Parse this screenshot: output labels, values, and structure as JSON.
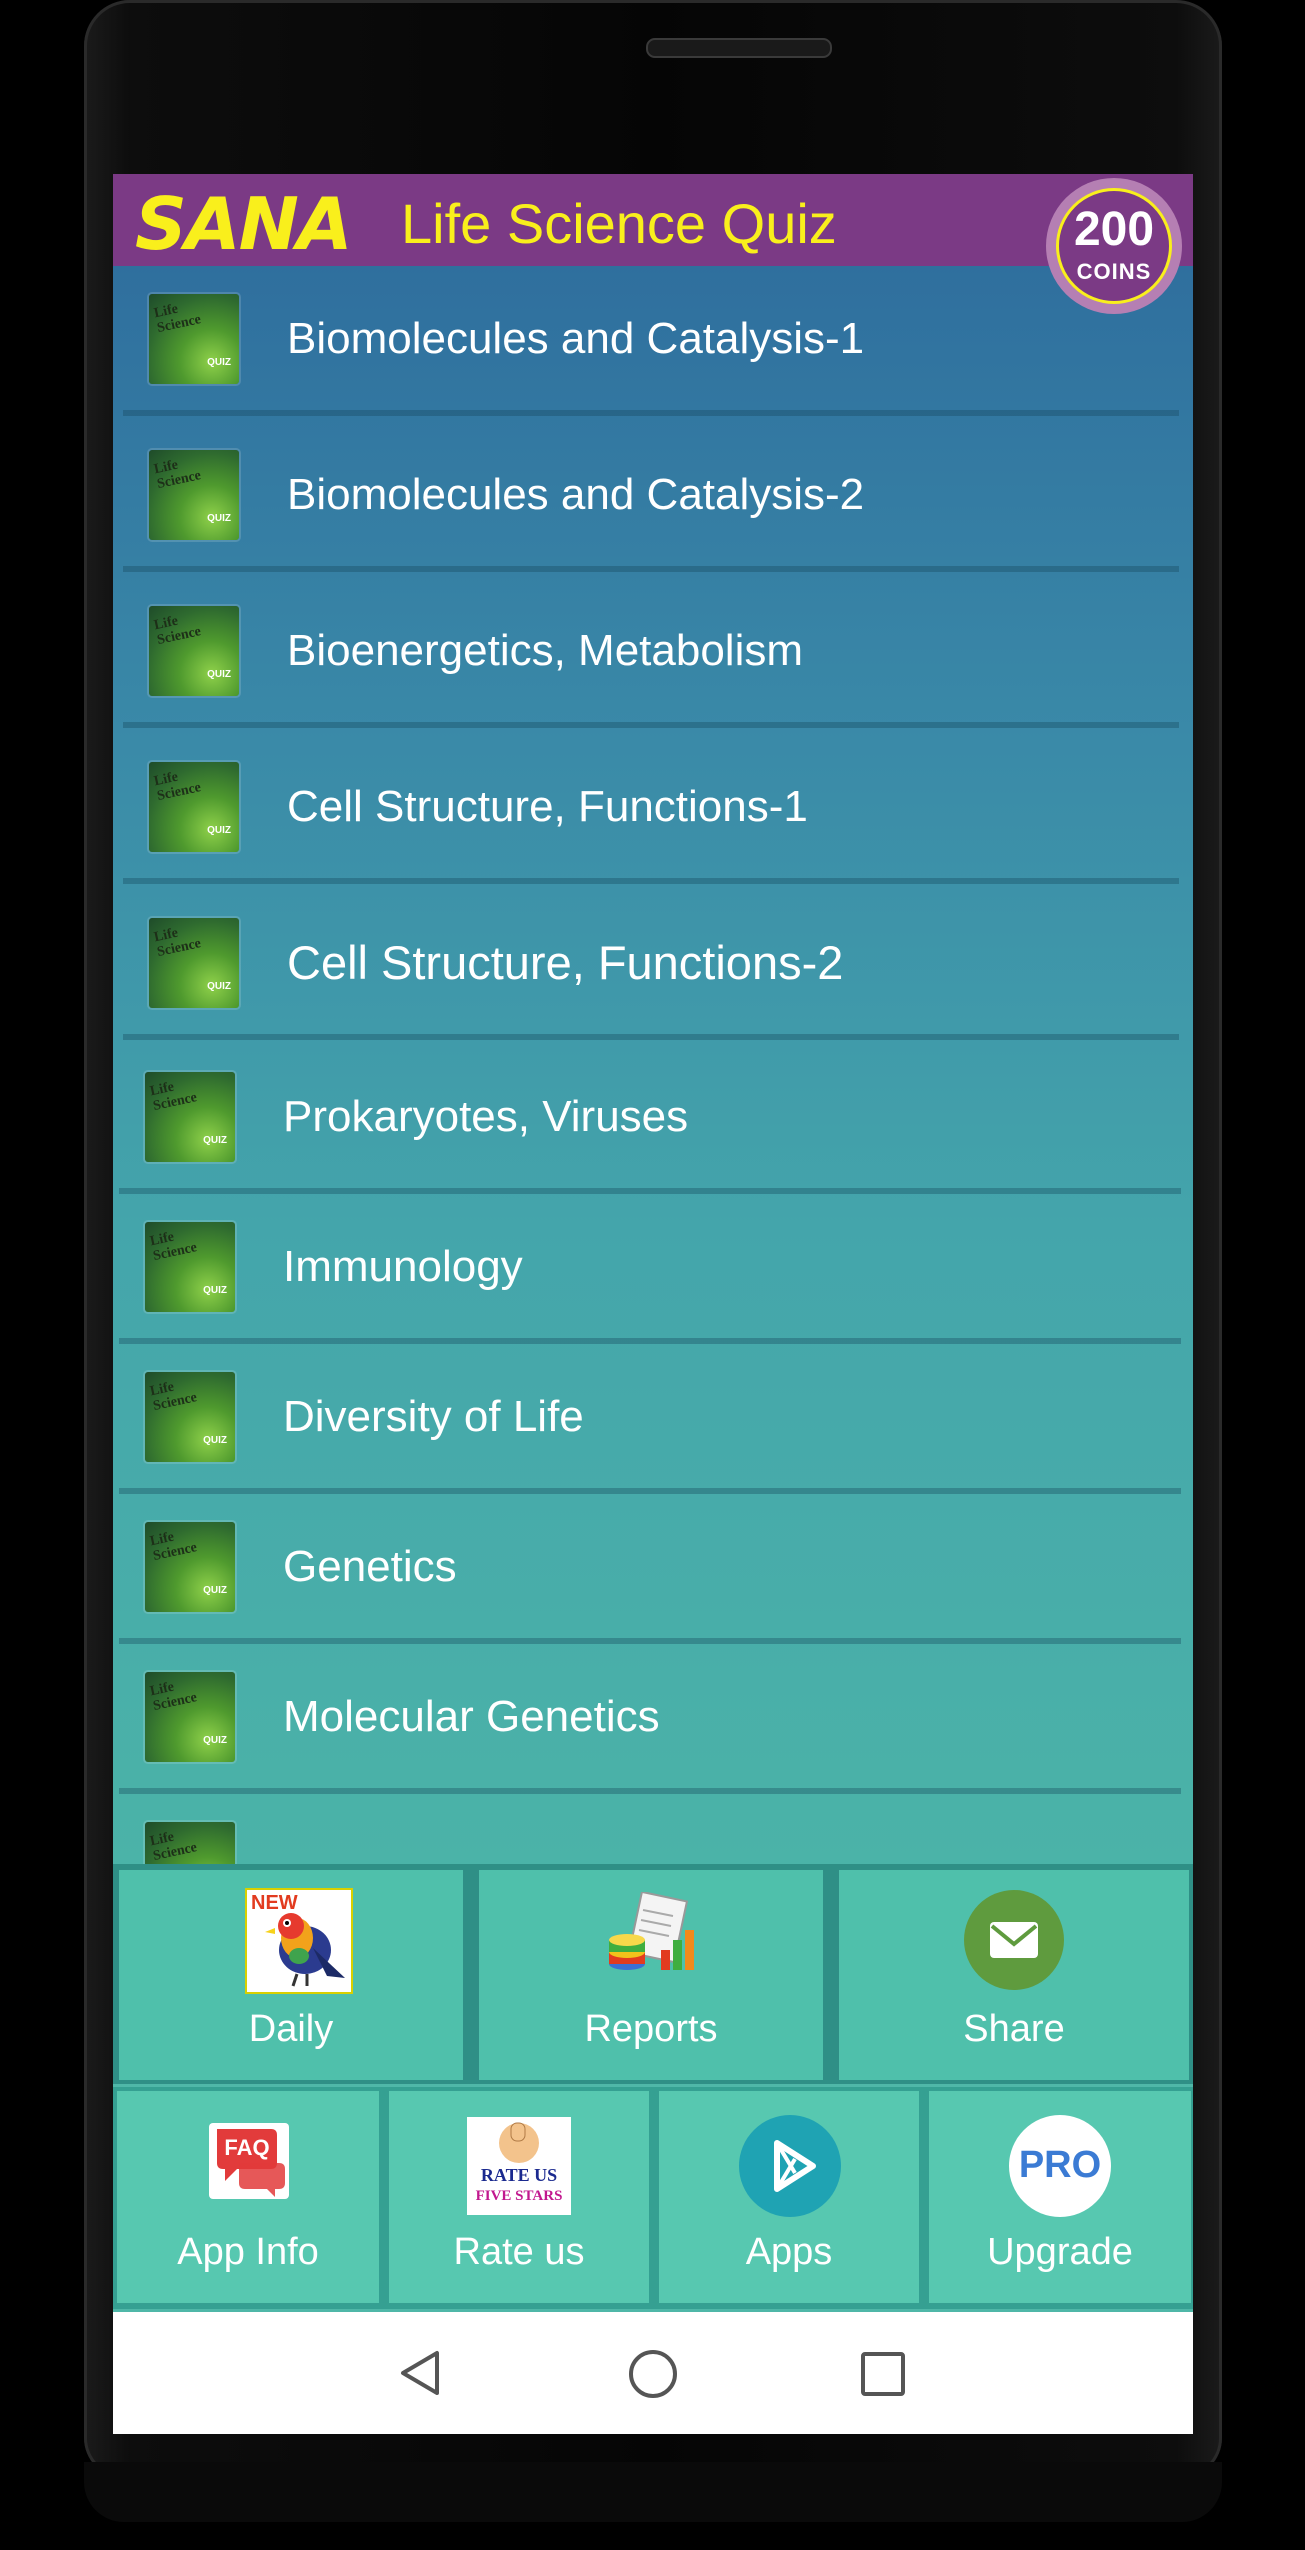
{
  "header": {
    "logo": "SANA",
    "title": "Life Science Quiz",
    "coins_value": "200",
    "coins_label": "COINS"
  },
  "thumbnail": {
    "line1": "Life",
    "line2": "Science",
    "line3": "QUIZ"
  },
  "topics": [
    "Biomolecules and Catalysis-1",
    "Biomolecules and Catalysis-2",
    "Bioenergetics, Metabolism",
    "Cell Structure, Functions-1",
    "Cell Structure, Functions-2",
    "Prokaryotes, Viruses",
    "Immunology",
    "Diversity of Life",
    "Genetics",
    "Molecular Genetics"
  ],
  "actions_row1": [
    {
      "label": "Daily",
      "icon": "new-bird-icon",
      "badge": "NEW"
    },
    {
      "label": "Reports",
      "icon": "reports-chart-icon"
    },
    {
      "label": "Share",
      "icon": "mail-icon"
    }
  ],
  "actions_row2": [
    {
      "label": "App Info",
      "icon": "faq-icon",
      "badge": "FAQ"
    },
    {
      "label": "Rate us",
      "icon": "rate-us-icon",
      "badge_line1": "RATE US",
      "badge_line2": "FIVE STARS"
    },
    {
      "label": "Apps",
      "icon": "play-icon"
    },
    {
      "label": "Upgrade",
      "icon": "pro-icon",
      "badge": "PRO"
    }
  ],
  "colors": {
    "header_bg": "#7b3a85",
    "title_color": "#f9ef1c",
    "list_top": "#2f6f9e",
    "list_bottom": "#4bb3a8",
    "action_bg": "#4fc0ab"
  }
}
